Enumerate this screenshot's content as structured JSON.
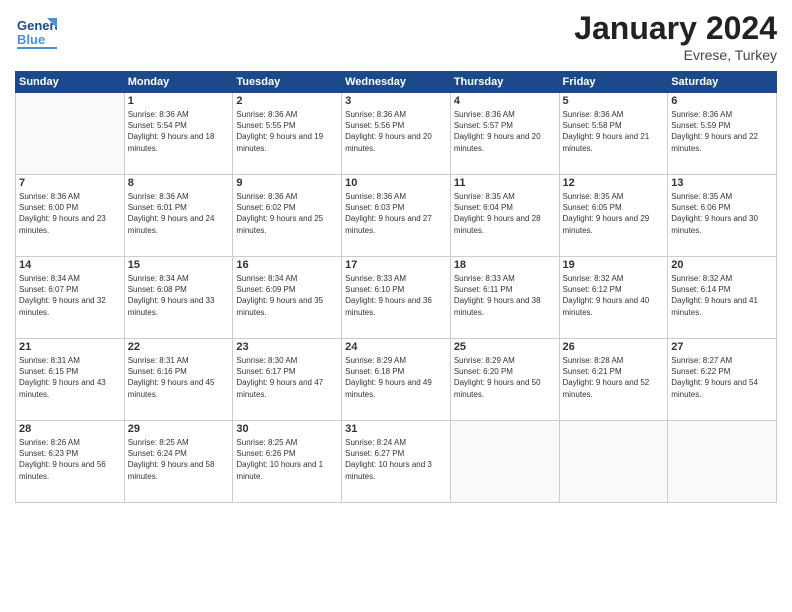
{
  "header": {
    "logo_general": "General",
    "logo_blue": "Blue",
    "title": "January 2024",
    "location": "Evrese, Turkey"
  },
  "weekdays": [
    "Sunday",
    "Monday",
    "Tuesday",
    "Wednesday",
    "Thursday",
    "Friday",
    "Saturday"
  ],
  "weeks": [
    [
      {
        "day": "",
        "sunrise": "",
        "sunset": "",
        "daylight": ""
      },
      {
        "day": "1",
        "sunrise": "Sunrise: 8:36 AM",
        "sunset": "Sunset: 5:54 PM",
        "daylight": "Daylight: 9 hours and 18 minutes."
      },
      {
        "day": "2",
        "sunrise": "Sunrise: 8:36 AM",
        "sunset": "Sunset: 5:55 PM",
        "daylight": "Daylight: 9 hours and 19 minutes."
      },
      {
        "day": "3",
        "sunrise": "Sunrise: 8:36 AM",
        "sunset": "Sunset: 5:56 PM",
        "daylight": "Daylight: 9 hours and 20 minutes."
      },
      {
        "day": "4",
        "sunrise": "Sunrise: 8:36 AM",
        "sunset": "Sunset: 5:57 PM",
        "daylight": "Daylight: 9 hours and 20 minutes."
      },
      {
        "day": "5",
        "sunrise": "Sunrise: 8:36 AM",
        "sunset": "Sunset: 5:58 PM",
        "daylight": "Daylight: 9 hours and 21 minutes."
      },
      {
        "day": "6",
        "sunrise": "Sunrise: 8:36 AM",
        "sunset": "Sunset: 5:59 PM",
        "daylight": "Daylight: 9 hours and 22 minutes."
      }
    ],
    [
      {
        "day": "7",
        "sunrise": "Sunrise: 8:36 AM",
        "sunset": "Sunset: 6:00 PM",
        "daylight": "Daylight: 9 hours and 23 minutes."
      },
      {
        "day": "8",
        "sunrise": "Sunrise: 8:36 AM",
        "sunset": "Sunset: 6:01 PM",
        "daylight": "Daylight: 9 hours and 24 minutes."
      },
      {
        "day": "9",
        "sunrise": "Sunrise: 8:36 AM",
        "sunset": "Sunset: 6:02 PM",
        "daylight": "Daylight: 9 hours and 25 minutes."
      },
      {
        "day": "10",
        "sunrise": "Sunrise: 8:36 AM",
        "sunset": "Sunset: 6:03 PM",
        "daylight": "Daylight: 9 hours and 27 minutes."
      },
      {
        "day": "11",
        "sunrise": "Sunrise: 8:35 AM",
        "sunset": "Sunset: 6:04 PM",
        "daylight": "Daylight: 9 hours and 28 minutes."
      },
      {
        "day": "12",
        "sunrise": "Sunrise: 8:35 AM",
        "sunset": "Sunset: 6:05 PM",
        "daylight": "Daylight: 9 hours and 29 minutes."
      },
      {
        "day": "13",
        "sunrise": "Sunrise: 8:35 AM",
        "sunset": "Sunset: 6:06 PM",
        "daylight": "Daylight: 9 hours and 30 minutes."
      }
    ],
    [
      {
        "day": "14",
        "sunrise": "Sunrise: 8:34 AM",
        "sunset": "Sunset: 6:07 PM",
        "daylight": "Daylight: 9 hours and 32 minutes."
      },
      {
        "day": "15",
        "sunrise": "Sunrise: 8:34 AM",
        "sunset": "Sunset: 6:08 PM",
        "daylight": "Daylight: 9 hours and 33 minutes."
      },
      {
        "day": "16",
        "sunrise": "Sunrise: 8:34 AM",
        "sunset": "Sunset: 6:09 PM",
        "daylight": "Daylight: 9 hours and 35 minutes."
      },
      {
        "day": "17",
        "sunrise": "Sunrise: 8:33 AM",
        "sunset": "Sunset: 6:10 PM",
        "daylight": "Daylight: 9 hours and 36 minutes."
      },
      {
        "day": "18",
        "sunrise": "Sunrise: 8:33 AM",
        "sunset": "Sunset: 6:11 PM",
        "daylight": "Daylight: 9 hours and 38 minutes."
      },
      {
        "day": "19",
        "sunrise": "Sunrise: 8:32 AM",
        "sunset": "Sunset: 6:12 PM",
        "daylight": "Daylight: 9 hours and 40 minutes."
      },
      {
        "day": "20",
        "sunrise": "Sunrise: 8:32 AM",
        "sunset": "Sunset: 6:14 PM",
        "daylight": "Daylight: 9 hours and 41 minutes."
      }
    ],
    [
      {
        "day": "21",
        "sunrise": "Sunrise: 8:31 AM",
        "sunset": "Sunset: 6:15 PM",
        "daylight": "Daylight: 9 hours and 43 minutes."
      },
      {
        "day": "22",
        "sunrise": "Sunrise: 8:31 AM",
        "sunset": "Sunset: 6:16 PM",
        "daylight": "Daylight: 9 hours and 45 minutes."
      },
      {
        "day": "23",
        "sunrise": "Sunrise: 8:30 AM",
        "sunset": "Sunset: 6:17 PM",
        "daylight": "Daylight: 9 hours and 47 minutes."
      },
      {
        "day": "24",
        "sunrise": "Sunrise: 8:29 AM",
        "sunset": "Sunset: 6:18 PM",
        "daylight": "Daylight: 9 hours and 49 minutes."
      },
      {
        "day": "25",
        "sunrise": "Sunrise: 8:29 AM",
        "sunset": "Sunset: 6:20 PM",
        "daylight": "Daylight: 9 hours and 50 minutes."
      },
      {
        "day": "26",
        "sunrise": "Sunrise: 8:28 AM",
        "sunset": "Sunset: 6:21 PM",
        "daylight": "Daylight: 9 hours and 52 minutes."
      },
      {
        "day": "27",
        "sunrise": "Sunrise: 8:27 AM",
        "sunset": "Sunset: 6:22 PM",
        "daylight": "Daylight: 9 hours and 54 minutes."
      }
    ],
    [
      {
        "day": "28",
        "sunrise": "Sunrise: 8:26 AM",
        "sunset": "Sunset: 6:23 PM",
        "daylight": "Daylight: 9 hours and 56 minutes."
      },
      {
        "day": "29",
        "sunrise": "Sunrise: 8:25 AM",
        "sunset": "Sunset: 6:24 PM",
        "daylight": "Daylight: 9 hours and 58 minutes."
      },
      {
        "day": "30",
        "sunrise": "Sunrise: 8:25 AM",
        "sunset": "Sunset: 6:26 PM",
        "daylight": "Daylight: 10 hours and 1 minute."
      },
      {
        "day": "31",
        "sunrise": "Sunrise: 8:24 AM",
        "sunset": "Sunset: 6:27 PM",
        "daylight": "Daylight: 10 hours and 3 minutes."
      },
      {
        "day": "",
        "sunrise": "",
        "sunset": "",
        "daylight": ""
      },
      {
        "day": "",
        "sunrise": "",
        "sunset": "",
        "daylight": ""
      },
      {
        "day": "",
        "sunrise": "",
        "sunset": "",
        "daylight": ""
      }
    ]
  ]
}
